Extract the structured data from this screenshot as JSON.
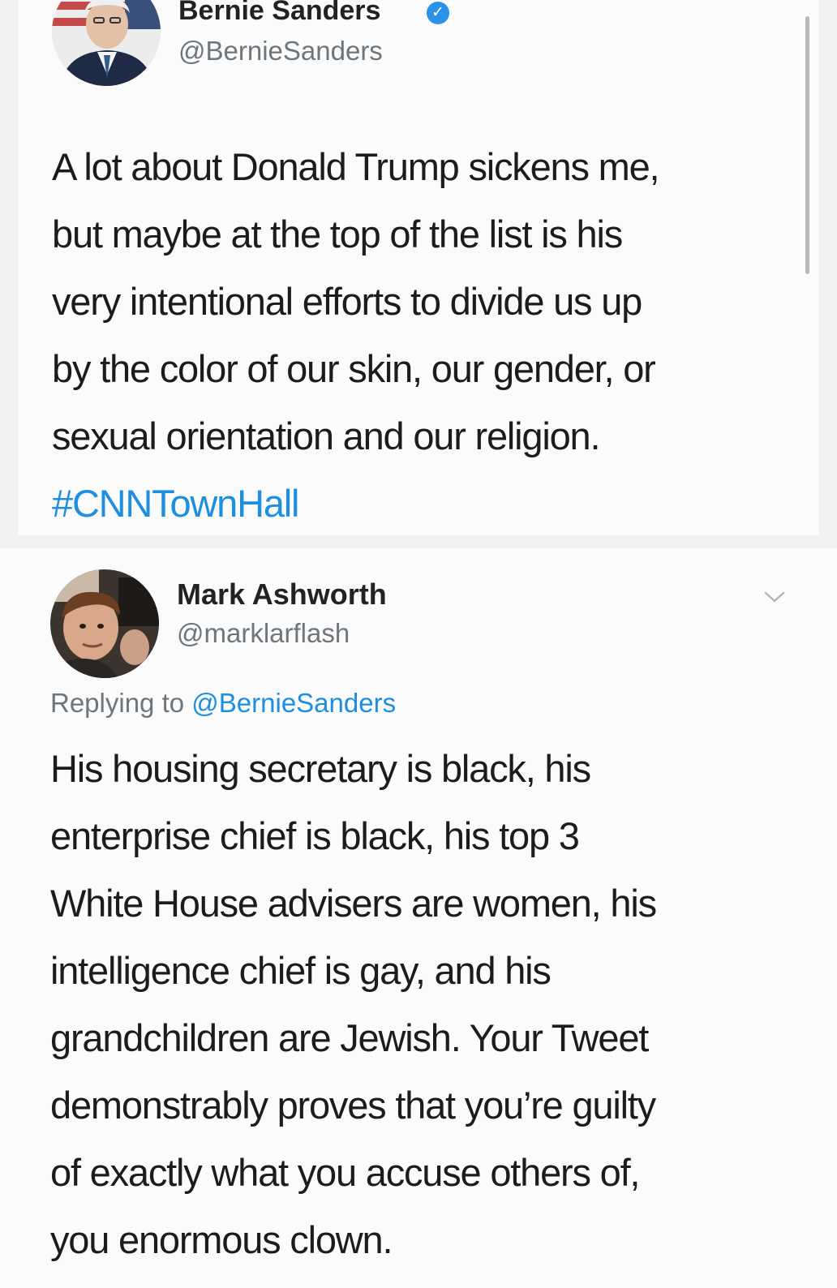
{
  "tweets": [
    {
      "display_name": "Bernie Sanders",
      "handle": "@BernieSanders",
      "verified": true,
      "avatar_icon": "bernie-sanders-avatar",
      "text_lines": [
        "A lot about Donald Trump sickens me,",
        "but maybe at the top of the list is his",
        "very intentional efforts to divide us up",
        "by the color of our skin, our gender, or",
        "sexual orientation and our religion."
      ],
      "hashtag": "#CNNTownHall"
    },
    {
      "display_name": "Mark Ashworth",
      "handle": "@marklarflash",
      "verified": false,
      "avatar_icon": "mark-ashworth-avatar",
      "reply_prefix": "Replying to",
      "reply_mention": "@BernieSanders",
      "text_lines": [
        "His housing secretary is black, his",
        "enterprise chief is black, his top 3",
        "White House advisers are women, his",
        "intelligence chief is gay, and his",
        "grandchildren are Jewish. Your Tweet",
        "demonstrably proves that you’re guilty",
        "of exactly what you accuse others of,",
        "you enormous clown."
      ]
    }
  ],
  "colors": {
    "link": "#1d8ee0",
    "verified": "#2a93e8",
    "secondary_text": "#6e767d",
    "background": "#f2f2f2",
    "card": "#fbfbfb"
  },
  "icons": {
    "verified": "verified-badge-icon",
    "more": "chevron-down-icon"
  }
}
